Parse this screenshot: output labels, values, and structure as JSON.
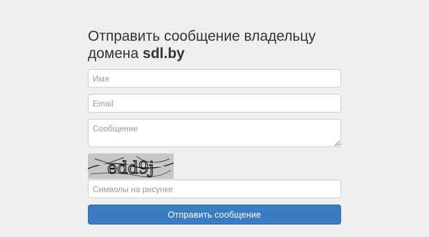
{
  "form": {
    "title_prefix": "Отправить сообщение владельцу домена ",
    "domain": "sdl.by",
    "name_placeholder": "Имя",
    "email_placeholder": "Email",
    "message_placeholder": "Сообщение",
    "captcha_placeholder": "Символы на рисунке",
    "submit_label": "Отправить сообщение"
  },
  "captcha": {
    "text": "edd9j",
    "colors": {
      "background": "#c7c7c7",
      "glyph": "#1a1a1a",
      "stroke": "#2a2a2a"
    }
  },
  "colors": {
    "page_background": "#efefef",
    "button": "#3a7cbf"
  }
}
